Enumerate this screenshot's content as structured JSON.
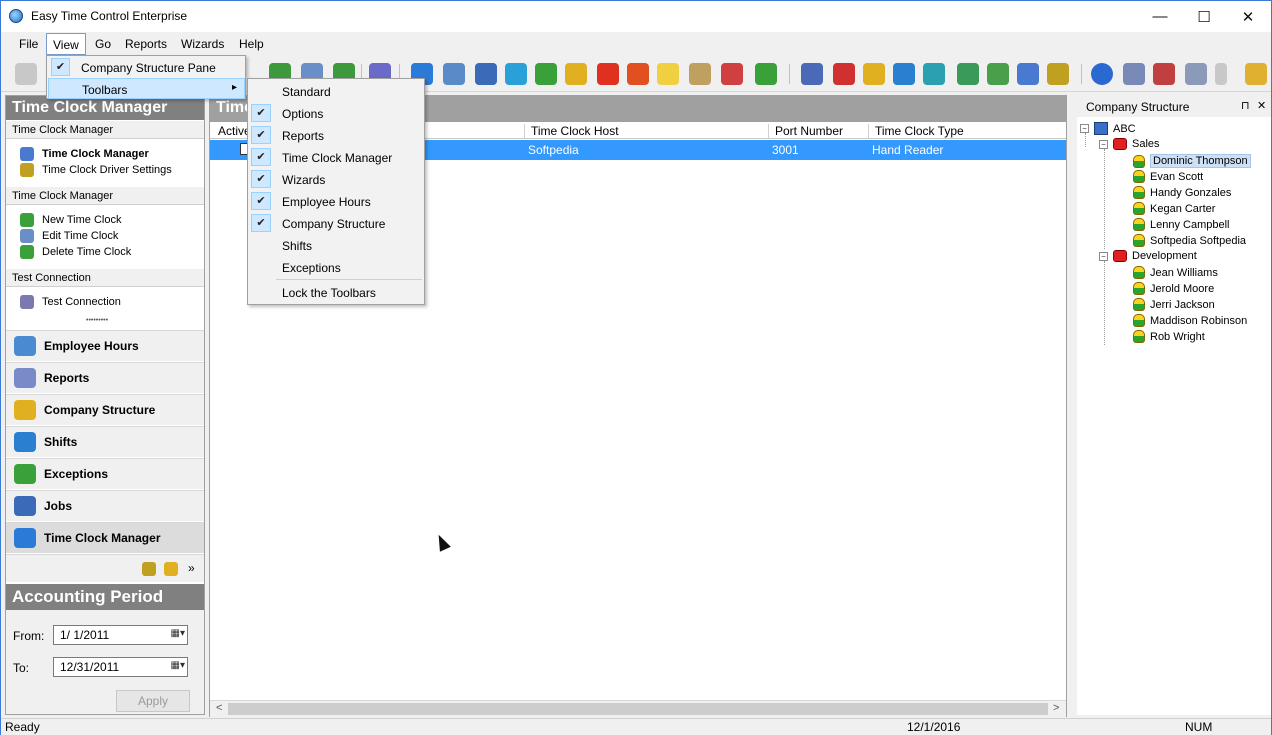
{
  "window": {
    "title": "Easy Time Control Enterprise",
    "min": "—",
    "max": "☐",
    "close": "✕"
  },
  "menubar": {
    "file": "File",
    "view": "View",
    "go": "Go",
    "reports": "Reports",
    "wizards": "Wizards",
    "help": "Help"
  },
  "view_menu": {
    "items": [
      {
        "label": "Company Structure Pane",
        "checked": true
      },
      {
        "label": "Toolbars",
        "submenu": true
      }
    ],
    "check_glyph": "✔",
    "arrow_glyph": "▸"
  },
  "toolbars_submenu": {
    "items": [
      {
        "label": "Standard",
        "checked": false
      },
      {
        "label": "Options",
        "checked": true
      },
      {
        "label": "Reports",
        "checked": true
      },
      {
        "label": "Time Clock Manager",
        "checked": true
      },
      {
        "label": "Wizards",
        "checked": true
      },
      {
        "label": "Employee Hours",
        "checked": true
      },
      {
        "label": "Company Structure",
        "checked": true
      },
      {
        "label": "Shifts",
        "checked": false
      },
      {
        "label": "Exceptions",
        "checked": false
      },
      {
        "label": "Lock the Toolbars",
        "checked": false
      }
    ]
  },
  "left_panel": {
    "title": "Time Clock Manager",
    "sections": [
      {
        "header": "Time Clock Manager",
        "items": [
          "Time Clock Manager",
          "Time Clock Driver Settings"
        ]
      },
      {
        "header": "Time Clock Manager",
        "items": [
          "New Time Clock",
          "Edit Time Clock",
          "Delete Time Clock"
        ]
      },
      {
        "header": "Test Connection",
        "items": [
          "Test Connection"
        ]
      }
    ],
    "grip": "•••••••••",
    "nav": [
      "Employee Hours",
      "Reports",
      "Company Structure",
      "Shifts",
      "Exceptions",
      "Jobs",
      "Time Clock Manager"
    ],
    "more_glyph": "»"
  },
  "accounting": {
    "title": "Accounting Period",
    "from_label": "From:",
    "from_value": "1/  1/2011",
    "to_label": "To:",
    "to_value": "12/31/2011",
    "apply": "Apply",
    "dd_glyph": "▦▾"
  },
  "center": {
    "title": "Time",
    "columns": [
      "Active",
      "Time Clock Host",
      "Port Number",
      "Time Clock Type"
    ],
    "row": {
      "host": "Softpedia",
      "port": "3001",
      "type": "Hand Reader"
    },
    "scroll_left": "<",
    "scroll_right": ">"
  },
  "right_panel": {
    "title": "Company Structure",
    "pin_glyph": "⊓",
    "close_glyph": "✕",
    "company": "ABC",
    "departments": [
      {
        "name": "Sales",
        "employees": [
          "Dominic Thompson",
          "Evan Scott",
          "Handy Gonzales",
          "Kegan Carter",
          "Lenny Campbell",
          "Softpedia Softpedia"
        ]
      },
      {
        "name": "Development",
        "employees": [
          "Jean Williams",
          "Jerold Moore",
          "Jerri Jackson",
          "Maddison Robinson",
          "Rob Wright"
        ]
      }
    ],
    "expander": "−"
  },
  "statusbar": {
    "status": "Ready",
    "date": "12/1/2016",
    "num": "NUM"
  }
}
